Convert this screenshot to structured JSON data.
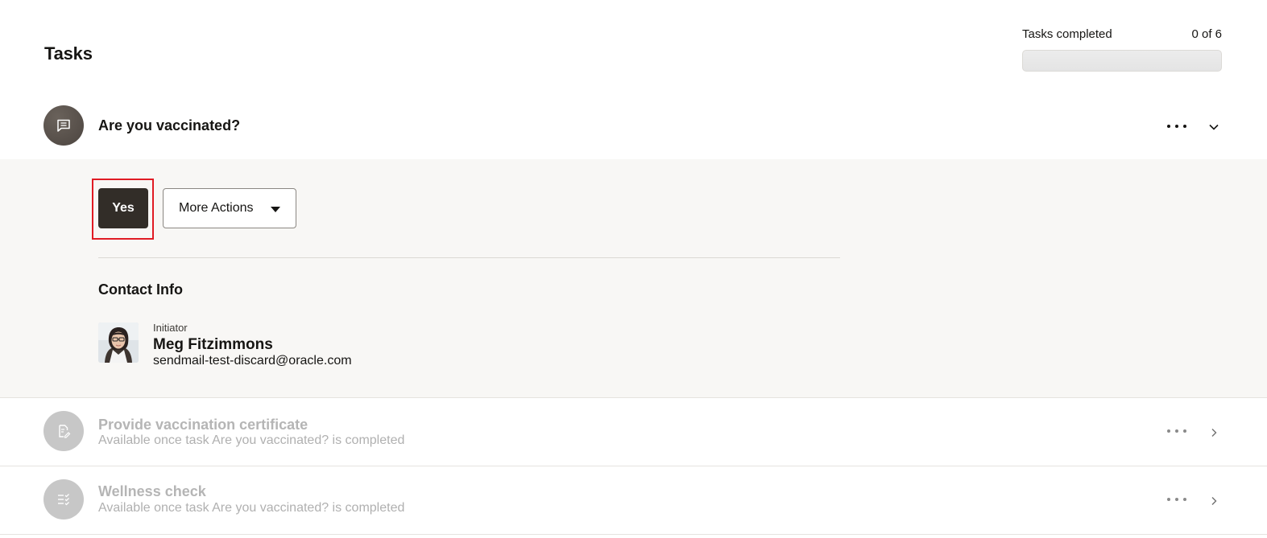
{
  "header": {
    "title": "Tasks",
    "progress_label": "Tasks completed",
    "progress_count": "0 of 6",
    "progress_fraction": 0
  },
  "tasks": [
    {
      "title": "Are you vaccinated?",
      "icon": "chat-icon",
      "state": "expanded",
      "actions": {
        "primary_label": "Yes",
        "more_label": "More Actions"
      },
      "contact": {
        "section_title": "Contact Info",
        "role": "Initiator",
        "name": "Meg Fitzimmons",
        "email": "sendmail-test-discard@oracle.com"
      }
    },
    {
      "title": "Provide vaccination certificate",
      "subtitle": "Available once task Are you vaccinated? is completed",
      "icon": "document-edit-icon",
      "state": "locked"
    },
    {
      "title": "Wellness check",
      "subtitle": "Available once task Are you vaccinated? is completed",
      "icon": "checklist-icon",
      "state": "locked"
    }
  ],
  "colors": {
    "primary_button": "#322d28",
    "highlight_outline": "#e01b24",
    "panel_background": "#f8f7f5",
    "disabled_text": "#b5b5b5"
  }
}
